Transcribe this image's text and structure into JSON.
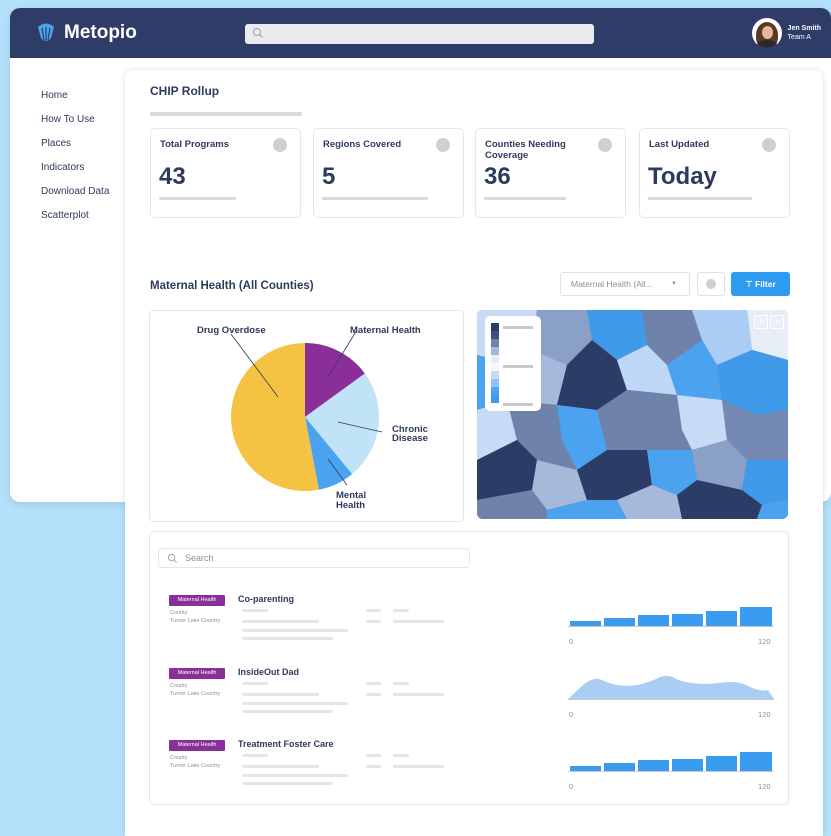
{
  "app": {
    "logo_text": "Metopio",
    "user_name": "Jen Smith",
    "user_team": "Team A"
  },
  "sidebar": {
    "items": [
      {
        "label": "Home"
      },
      {
        "label": "How To Use"
      },
      {
        "label": "Places"
      },
      {
        "label": "Indicators"
      },
      {
        "label": "Download Data"
      },
      {
        "label": "Scatterplot"
      }
    ]
  },
  "page": {
    "title": "CHIP Rollup"
  },
  "stats": [
    {
      "label": "Total Programs",
      "value": "43"
    },
    {
      "label": "Regions Covered",
      "value": "5"
    },
    {
      "label": "Counties Needing Coverage",
      "value": "36"
    },
    {
      "label": "Last Updated",
      "value": "Today"
    }
  ],
  "section": {
    "title": "Maternal Health (All Counties)",
    "dropdown_value": "Maternal Health (All...",
    "filter_label": "Filter"
  },
  "chart_data": {
    "type": "pie",
    "categories": [
      "Maternal Health",
      "Chronic Disease",
      "Mental Health",
      "Drug Overdose"
    ],
    "values": [
      15,
      24,
      8,
      53
    ],
    "colors": [
      "#8a2f9a",
      "#c1e3f8",
      "#4ba3ef",
      "#f5c242"
    ]
  },
  "pie_labels": {
    "maternal": "Maternal Health",
    "chronic_1": "Chronic",
    "chronic_2": "Disease",
    "mental_1": "Mental",
    "mental_2": "Health",
    "drug": "Drug Overdose"
  },
  "list": {
    "search_placeholder": "Search",
    "items": [
      {
        "tag": "Maternal Health",
        "name": "Co-parenting",
        "meta_1": "County",
        "meta_2": "Turner Lake Country",
        "axis_min": "0",
        "axis_max": "120"
      },
      {
        "tag": "Maternal Health",
        "name": "InsideOut Dad",
        "meta_1": "County",
        "meta_2": "Turner Lake Country",
        "axis_min": "0",
        "axis_max": "120"
      },
      {
        "tag": "Maternal Health",
        "name": "Treatment Foster Care",
        "meta_1": "County",
        "meta_2": "Turner Lake Country",
        "axis_min": "0",
        "axis_max": "120"
      }
    ]
  },
  "colors": {
    "navbar": "#2e3c67",
    "accent": "#2d9cf0",
    "tag": "#8a2f9a"
  }
}
